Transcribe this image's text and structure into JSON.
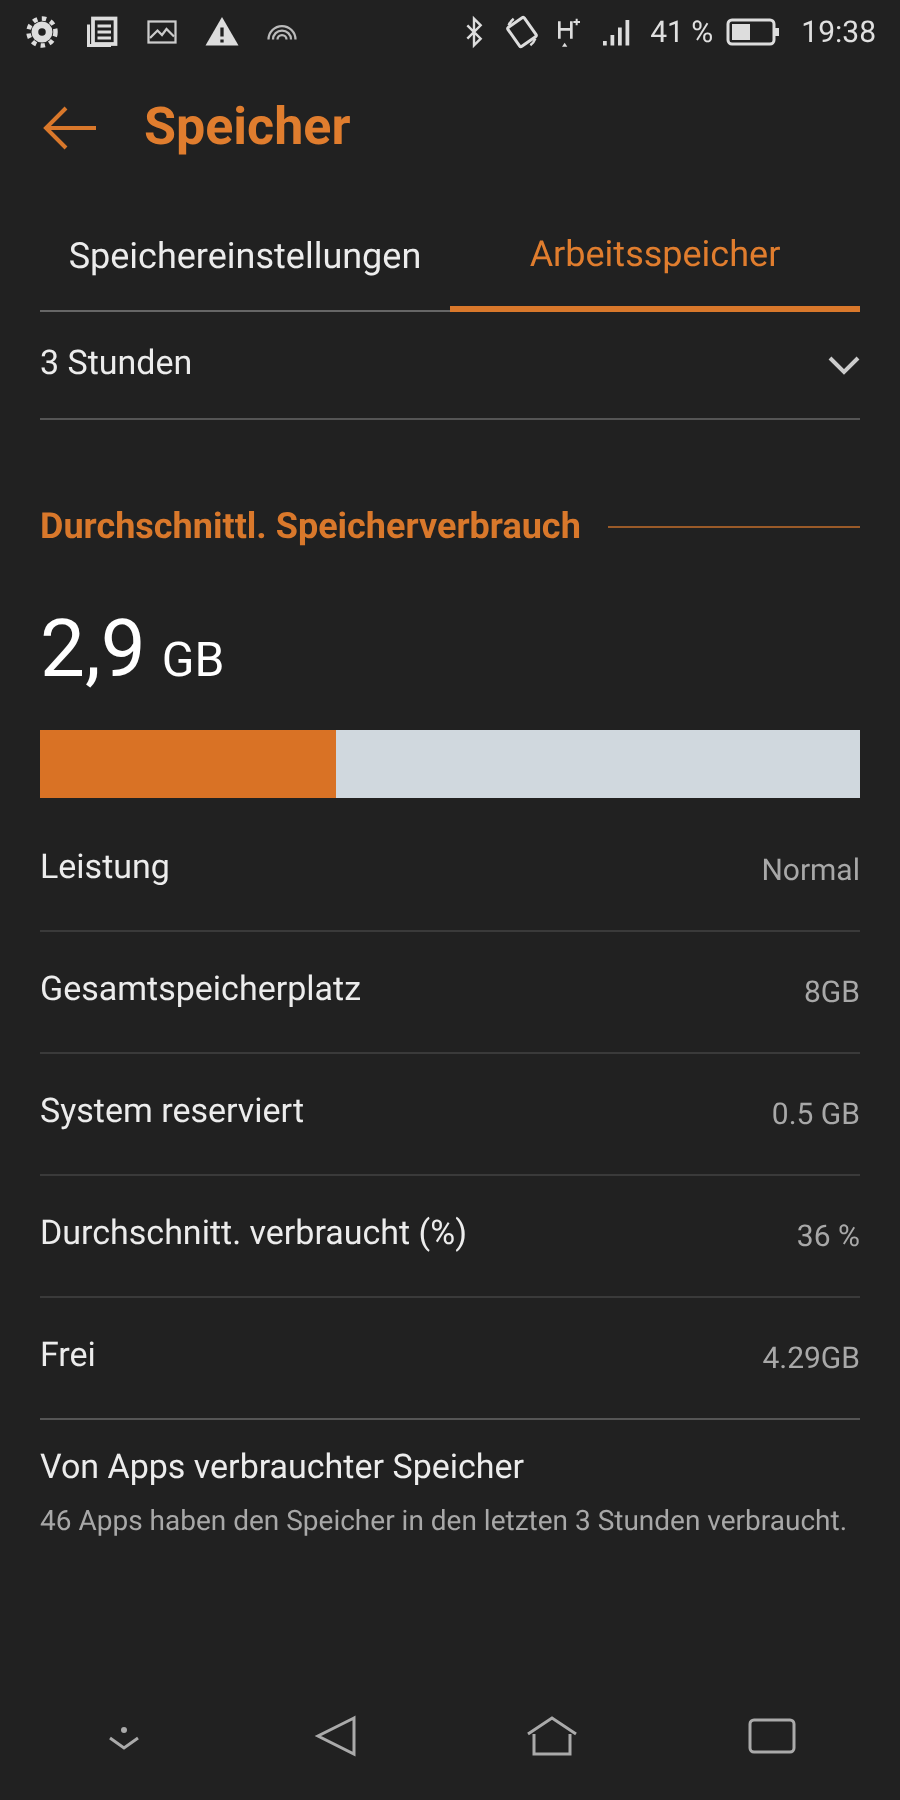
{
  "status_bar": {
    "battery": "41 %",
    "time": "19:38"
  },
  "header": {
    "title": "Speicher"
  },
  "tabs": [
    {
      "label": "Speichereinstellungen",
      "selected": false
    },
    {
      "label": "Arbeitsspeicher",
      "selected": true
    }
  ],
  "time_range": {
    "value": "3 Stunden"
  },
  "section": {
    "title": "Durchschnittl. Speicherverbrauch",
    "amount": "2,9",
    "unit": "GB",
    "level": 0.36
  },
  "rows": [
    {
      "label": "Leistung",
      "value": "Normal"
    },
    {
      "label": "Gesamtspeicherplatz",
      "value": "8GB"
    },
    {
      "label": "System reserviert",
      "value": "0.5 GB"
    },
    {
      "label": "Durchschnitt. verbraucht (%)",
      "value": "36 %"
    },
    {
      "label": "Frei",
      "value": "4.29GB"
    }
  ],
  "apps": {
    "title": "Von Apps verbrauchter Speicher",
    "description": "46 Apps haben den Speicher in den letzten 3 Stunden verbraucht."
  }
}
